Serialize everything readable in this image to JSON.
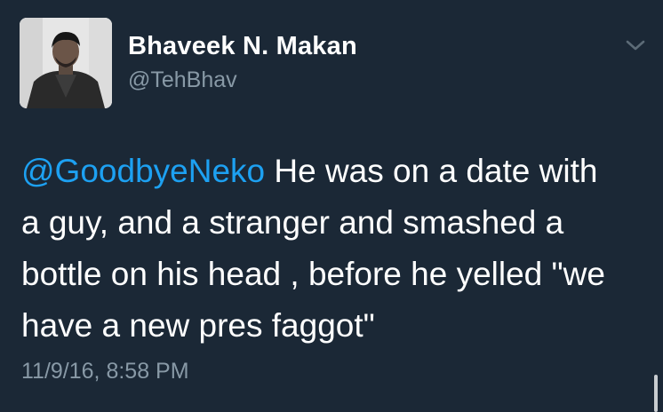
{
  "user": {
    "display_name": "Bhaveek N. Makan",
    "handle": "@TehBhav"
  },
  "tweet": {
    "mention": "@GoodbyeNeko",
    "line1_rest": " He was on a date with",
    "line2": "a guy, and a stranger and smashed a",
    "line3": "bottle on his head , before he yelled \"we",
    "line4": "have a new pres faggot\"",
    "timestamp": "11/9/16, 8:58 PM"
  },
  "icons": {
    "menu": "chevron-down-icon"
  },
  "colors": {
    "background": "#1b2836",
    "text": "#ffffff",
    "secondary": "#8899a6",
    "link": "#1da1f2"
  }
}
